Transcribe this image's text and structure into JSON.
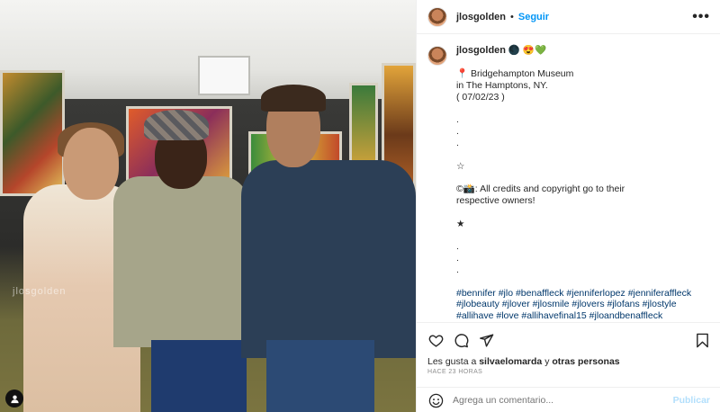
{
  "photo": {
    "watermark": "jlosgolden",
    "tagged_user_icon": "user-icon"
  },
  "header": {
    "username": "jlosgolden",
    "dot": "•",
    "follow_label": "Seguir",
    "more_icon": "ellipsis-icon",
    "more_label": "•••"
  },
  "caption": {
    "username": "jlosgolden",
    "emojis": "🌑 😍💚",
    "location_line1": "📍 Bridgehampton Museum",
    "location_line2": "in The Hamptons, NY.",
    "date": "( 07/02/23 )",
    "dot1": ".",
    "dot2": ".",
    "dot3": ".",
    "star_outline": "☆",
    "credits_line1": "©📸: All credits and copyright go to their",
    "credits_line2": "respective owners!",
    "star_solid": "★",
    "dot4": ".",
    "dot5": ".",
    "dot6": ".",
    "hashtags": "#bennifer #jlo #benaffleck #jenniferlopez #jenniferaffleck #jlobeauty #jlover #jlosmile #jlovers #jlofans #jlostyle #allihave #love #allihavefinal15 #jloandbenaffleck #ramona #jlochallenge #ontheG #jlotiktokchallenge #jennyfromtheblock"
  },
  "actions": {
    "like_icon": "heart-icon",
    "comment_icon": "comment-icon",
    "share_icon": "share-icon",
    "save_icon": "bookmark-icon",
    "likes_prefix": "Les gusta a",
    "likes_user": "silvaelomarda",
    "likes_mid": "y",
    "likes_others": "otras personas",
    "timestamp": "HACE 23 HORAS"
  },
  "comment_box": {
    "emoji_icon": "smiley-icon",
    "placeholder": "Agrega un comentario...",
    "post_label": "Publicar"
  },
  "colors": {
    "link": "#0095f6",
    "hashtag": "#00376b",
    "post_disabled": "#b2dffc"
  }
}
